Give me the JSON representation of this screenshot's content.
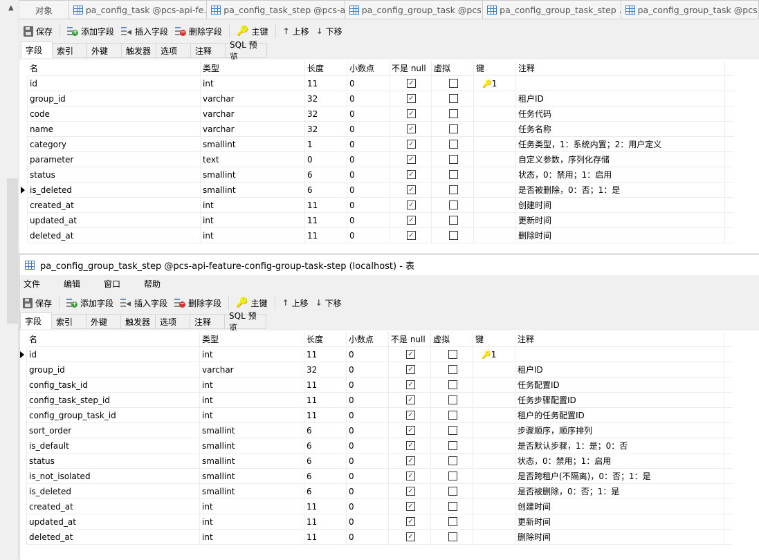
{
  "object_tabs": [
    {
      "label": "对象",
      "icon": "none"
    },
    {
      "label": "pa_config_task @pcs-api-fe...",
      "icon": "table-icon"
    },
    {
      "label": "pa_config_task_step @pcs-a...",
      "icon": "table-icon"
    },
    {
      "label": "pa_config_group_task @pcs...",
      "icon": "table-icon"
    },
    {
      "label": "pa_config_group_task_step ...",
      "icon": "table-icon"
    },
    {
      "label": "pa_config_group_task @pcs...",
      "icon": "table-design-icon"
    }
  ],
  "toolbar": {
    "save": "保存",
    "add_field": "添加字段",
    "insert_field": "插入字段",
    "delete_field": "删除字段",
    "primary_key": "主键",
    "move_up": "上移",
    "move_down": "下移"
  },
  "inner_tabs": [
    "字段",
    "索引",
    "外键",
    "触发器",
    "选项",
    "注释",
    "SQL 预览"
  ],
  "columns": [
    "名",
    "类型",
    "长度",
    "小数点",
    "不是 null",
    "虚拟",
    "键",
    "注释"
  ],
  "top_table": {
    "selected_row": 7,
    "rows": [
      {
        "name": "id",
        "type": "int",
        "length": "11",
        "decimals": "0",
        "not_null": true,
        "virtual": false,
        "key": "1",
        "comment": ""
      },
      {
        "name": "group_id",
        "type": "varchar",
        "length": "32",
        "decimals": "0",
        "not_null": true,
        "virtual": false,
        "key": "",
        "comment": "租户ID"
      },
      {
        "name": "code",
        "type": "varchar",
        "length": "32",
        "decimals": "0",
        "not_null": true,
        "virtual": false,
        "key": "",
        "comment": "任务代码"
      },
      {
        "name": "name",
        "type": "varchar",
        "length": "32",
        "decimals": "0",
        "not_null": true,
        "virtual": false,
        "key": "",
        "comment": "任务名称"
      },
      {
        "name": "category",
        "type": "smallint",
        "length": "1",
        "decimals": "0",
        "not_null": true,
        "virtual": false,
        "key": "",
        "comment": "任务类型，1：系统内置；2：用户定义"
      },
      {
        "name": "parameter",
        "type": "text",
        "length": "0",
        "decimals": "0",
        "not_null": true,
        "virtual": false,
        "key": "",
        "comment": "自定义参数，序列化存储"
      },
      {
        "name": "status",
        "type": "smallint",
        "length": "6",
        "decimals": "0",
        "not_null": true,
        "virtual": false,
        "key": "",
        "comment": "状态，0：禁用；1：启用"
      },
      {
        "name": "is_deleted",
        "type": "smallint",
        "length": "6",
        "decimals": "0",
        "not_null": true,
        "virtual": false,
        "key": "",
        "comment": "是否被删除，0：否；1：是"
      },
      {
        "name": "created_at",
        "type": "int",
        "length": "11",
        "decimals": "0",
        "not_null": true,
        "virtual": false,
        "key": "",
        "comment": "创建时间"
      },
      {
        "name": "updated_at",
        "type": "int",
        "length": "11",
        "decimals": "0",
        "not_null": true,
        "virtual": false,
        "key": "",
        "comment": "更新时间"
      },
      {
        "name": "deleted_at",
        "type": "int",
        "length": "11",
        "decimals": "0",
        "not_null": true,
        "virtual": false,
        "key": "",
        "comment": "删除时间"
      }
    ]
  },
  "window": {
    "title": "pa_config_group_task_step @pcs-api-feature-config-group-task-step (localhost) - 表",
    "menu": [
      "文件",
      "编辑",
      "窗口",
      "帮助"
    ],
    "selected_row": 0,
    "rows": [
      {
        "name": "id",
        "type": "int",
        "length": "11",
        "decimals": "0",
        "not_null": true,
        "virtual": false,
        "key": "1",
        "comment": ""
      },
      {
        "name": "group_id",
        "type": "varchar",
        "length": "32",
        "decimals": "0",
        "not_null": true,
        "virtual": false,
        "key": "",
        "comment": "租户ID"
      },
      {
        "name": "config_task_id",
        "type": "int",
        "length": "11",
        "decimals": "0",
        "not_null": true,
        "virtual": false,
        "key": "",
        "comment": "任务配置ID"
      },
      {
        "name": "config_task_step_id",
        "type": "int",
        "length": "11",
        "decimals": "0",
        "not_null": true,
        "virtual": false,
        "key": "",
        "comment": "任务步骤配置ID"
      },
      {
        "name": "config_group_task_id",
        "type": "int",
        "length": "11",
        "decimals": "0",
        "not_null": true,
        "virtual": false,
        "key": "",
        "comment": "租户的任务配置ID"
      },
      {
        "name": "sort_order",
        "type": "smallint",
        "length": "6",
        "decimals": "0",
        "not_null": true,
        "virtual": false,
        "key": "",
        "comment": "步骤顺序，顺序排列"
      },
      {
        "name": "is_default",
        "type": "smallint",
        "length": "6",
        "decimals": "0",
        "not_null": true,
        "virtual": false,
        "key": "",
        "comment": "是否默认步骤，1：是；0：否"
      },
      {
        "name": "status",
        "type": "smallint",
        "length": "6",
        "decimals": "0",
        "not_null": true,
        "virtual": false,
        "key": "",
        "comment": "状态，0：禁用；1：启用"
      },
      {
        "name": "is_not_isolated",
        "type": "smallint",
        "length": "6",
        "decimals": "0",
        "not_null": true,
        "virtual": false,
        "key": "",
        "comment": "是否跨租户(不隔离)，0：否；1：是"
      },
      {
        "name": "is_deleted",
        "type": "smallint",
        "length": "6",
        "decimals": "0",
        "not_null": true,
        "virtual": false,
        "key": "",
        "comment": "是否被删除，0：否；1：是"
      },
      {
        "name": "created_at",
        "type": "int",
        "length": "11",
        "decimals": "0",
        "not_null": true,
        "virtual": false,
        "key": "",
        "comment": "创建时间"
      },
      {
        "name": "updated_at",
        "type": "int",
        "length": "11",
        "decimals": "0",
        "not_null": true,
        "virtual": false,
        "key": "",
        "comment": "更新时间"
      },
      {
        "name": "deleted_at",
        "type": "int",
        "length": "11",
        "decimals": "0",
        "not_null": true,
        "virtual": false,
        "key": "",
        "comment": "删除时间"
      }
    ]
  }
}
